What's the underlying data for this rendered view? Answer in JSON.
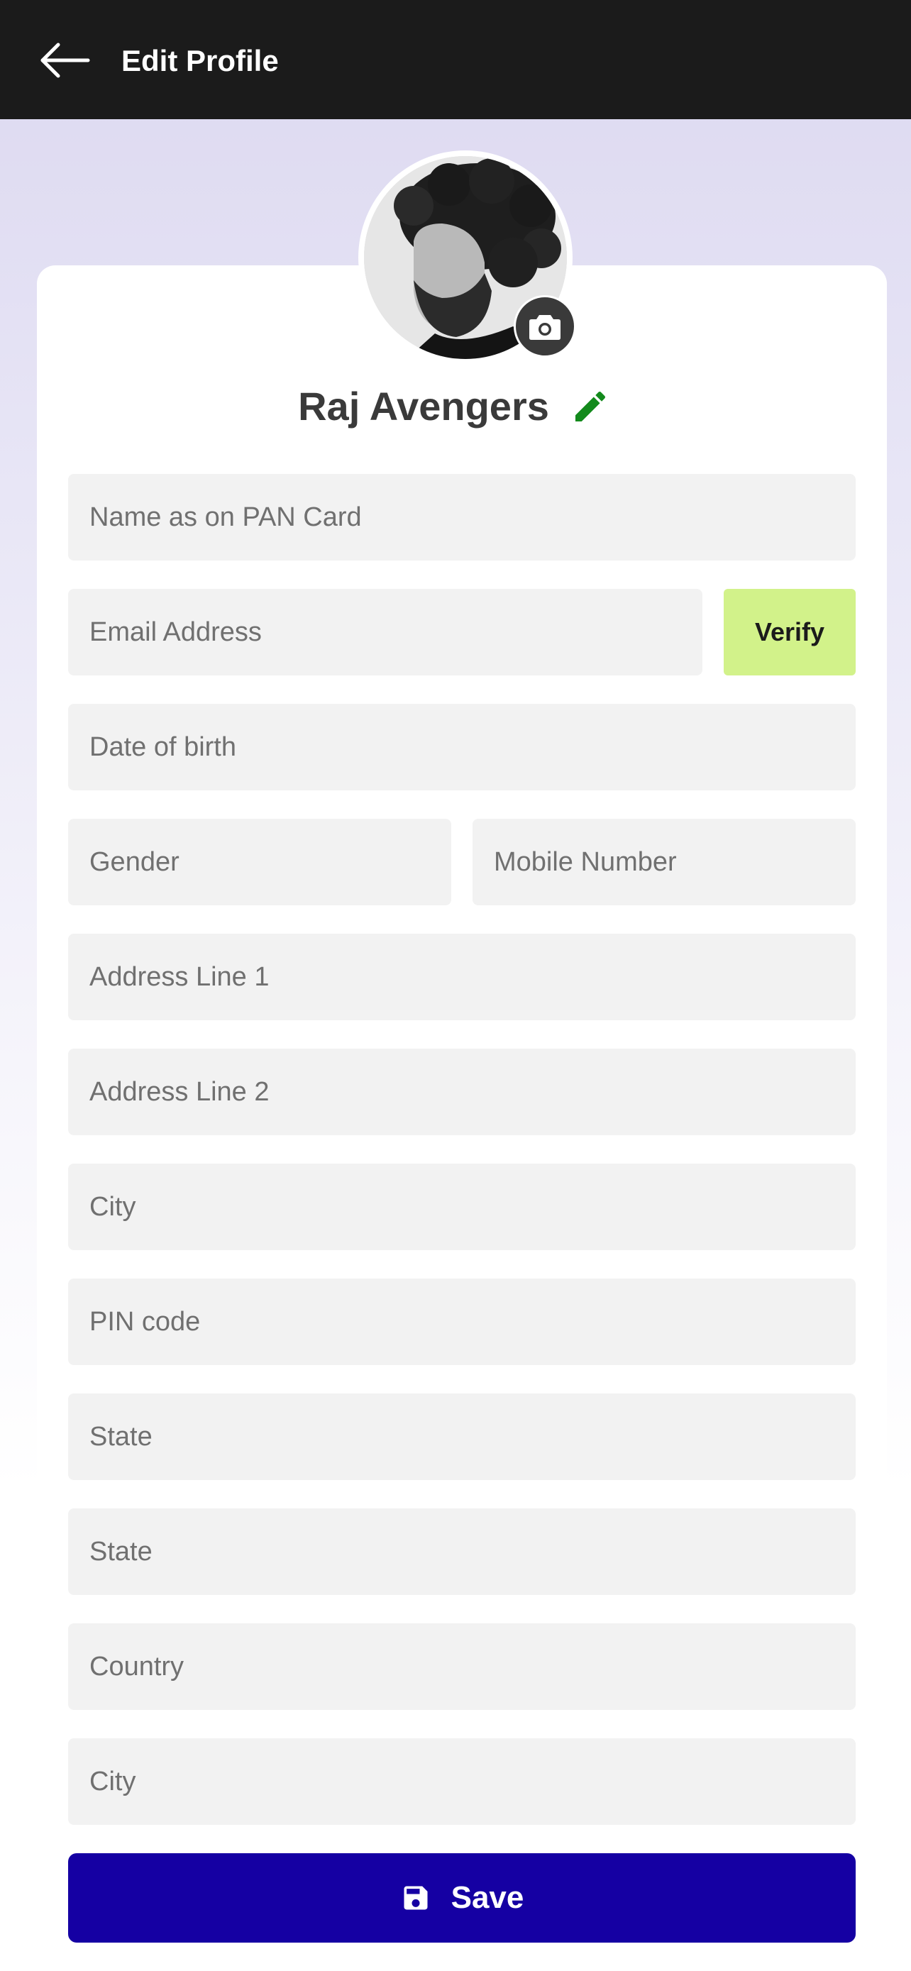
{
  "header": {
    "title": "Edit Profile",
    "back_icon": "arrow-left-icon"
  },
  "profile": {
    "name": "Raj Avengers",
    "avatar_icon": "user-photo",
    "camera_icon": "camera-icon",
    "edit_icon": "pencil-icon",
    "edit_icon_color": "#138a1c"
  },
  "form": {
    "pan_name": {
      "placeholder": "Name as on PAN Card",
      "value": ""
    },
    "email": {
      "placeholder": "Email Address",
      "value": ""
    },
    "verify_label": "Verify",
    "dob": {
      "placeholder": "Date of birth",
      "value": ""
    },
    "gender": {
      "placeholder": "Gender",
      "value": ""
    },
    "mobile": {
      "placeholder": "Mobile Number",
      "value": ""
    },
    "address1": {
      "placeholder": "Address Line 1",
      "value": ""
    },
    "address2": {
      "placeholder": "Address Line 2",
      "value": ""
    },
    "city": {
      "placeholder": "City",
      "value": ""
    },
    "pin": {
      "placeholder": "PIN code",
      "value": ""
    },
    "state": {
      "placeholder": "State",
      "value": ""
    },
    "state2": {
      "placeholder": "State",
      "value": ""
    },
    "country": {
      "placeholder": "Country",
      "value": ""
    },
    "city2": {
      "placeholder": "City",
      "value": ""
    }
  },
  "save": {
    "label": "Save",
    "icon": "floppy-disk-icon"
  },
  "colors": {
    "appbar_bg": "#1b1b1b",
    "verify_bg": "#d2f28a",
    "save_bg": "#1500a3",
    "field_bg": "#f2f2f2"
  }
}
